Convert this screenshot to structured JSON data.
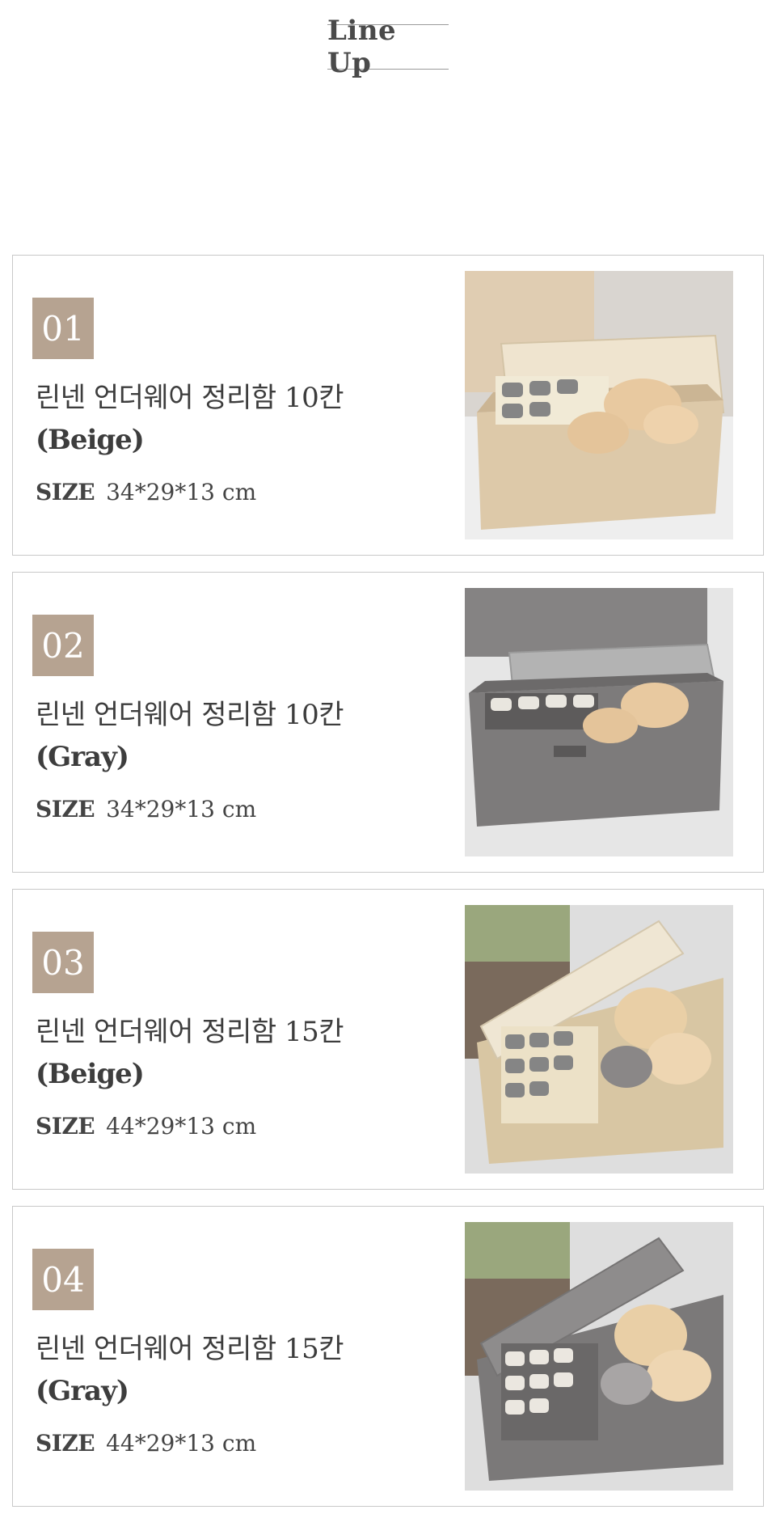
{
  "heading": "Line Up",
  "items": [
    {
      "num": "01",
      "name": "린넨 언더웨어 정리함 10칸",
      "color": "(Beige)",
      "size_label": "SIZE",
      "size": "34*29*13 cm",
      "tone": "beige"
    },
    {
      "num": "02",
      "name": "린넨 언더웨어 정리함 10칸",
      "color": "(Gray)",
      "size_label": "SIZE",
      "size": "34*29*13 cm",
      "tone": "gray"
    },
    {
      "num": "03",
      "name": "린넨 언더웨어 정리함 15칸",
      "color": "(Beige)",
      "size_label": "SIZE",
      "size": "44*29*13 cm",
      "tone": "beige"
    },
    {
      "num": "04",
      "name": "린넨 언더웨어 정리함 15칸",
      "color": "(Gray)",
      "size_label": "SIZE",
      "size": "44*29*13 cm",
      "tone": "gray"
    }
  ],
  "colors": {
    "badge": "#b6a391",
    "border": "#c8c8c8",
    "beige_box": "#e3d3b9",
    "gray_box": "#7b7a7a"
  }
}
